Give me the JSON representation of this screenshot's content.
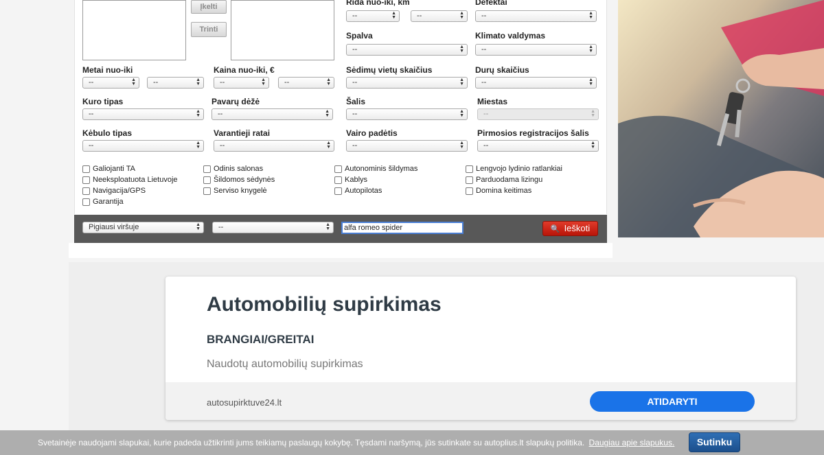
{
  "colors": {
    "search_red": "#c8200f",
    "ad_blue": "#1a73e8",
    "cookie_blue": "#1c4f8c",
    "search_bar": "#585858"
  },
  "icons": {
    "search": "magnifier-icon",
    "select_arrow": "updown-arrows-icon"
  },
  "make_model": {
    "upload_label": "Įkelti",
    "delete_label": "Trinti"
  },
  "filters": {
    "labels": {
      "mileage": "Rida nuo-iki, km",
      "defects": "Defektai",
      "color": "Spalva",
      "climate": "Klimato valdymas",
      "year": "Metai nuo-iki",
      "price": "Kaina nuo-iki, €",
      "seats": "Sėdimų vietų skaičius",
      "doors": "Durų skaičius",
      "fuel": "Kuro tipas",
      "gearbox": "Pavarų dėžė",
      "country": "Šalis",
      "city": "Miestas",
      "body": "Kėbulo tipas",
      "drive": "Varantieji ratai",
      "steering": "Vairo padėtis",
      "first_reg_country": "Pirmosios registracijos šalis"
    },
    "placeholder": "--"
  },
  "checkboxes": [
    "Galiojanti TA",
    "Neeksploatuota Lietuvoje",
    "Navigacija/GPS",
    "Garantija",
    "Odinis salonas",
    "Šildomos sėdynės",
    "Serviso knygelė",
    "Autonominis šildymas",
    "Kablys",
    "Autopilotas",
    "Lengvojo lydinio ratlankiai",
    "Parduodama lizingu",
    "Domina keitimas"
  ],
  "search_bar": {
    "sort": "Pigiausi viršuje",
    "second": "--",
    "keyword": "alfa romeo spider",
    "search_label": "Ieškoti"
  },
  "ad": {
    "title": "Automobilių supirkimas",
    "subtitle": "BRANGIAI/GREITAI",
    "description": "Naudotų automobilių supirkimas",
    "domain": "autosupirktuve24.lt",
    "open_label": "ATIDARYTI"
  },
  "cookie": {
    "text": "Svetainėje naudojami slapukai, kurie padeda užtikrinti jums teikiamų paslaugų kokybę. Tęsdami naršymą, jūs sutinkate su autoplius.lt slapukų politika.",
    "more": "Daugiau apie slapukus.",
    "accept": "Sutinku"
  }
}
